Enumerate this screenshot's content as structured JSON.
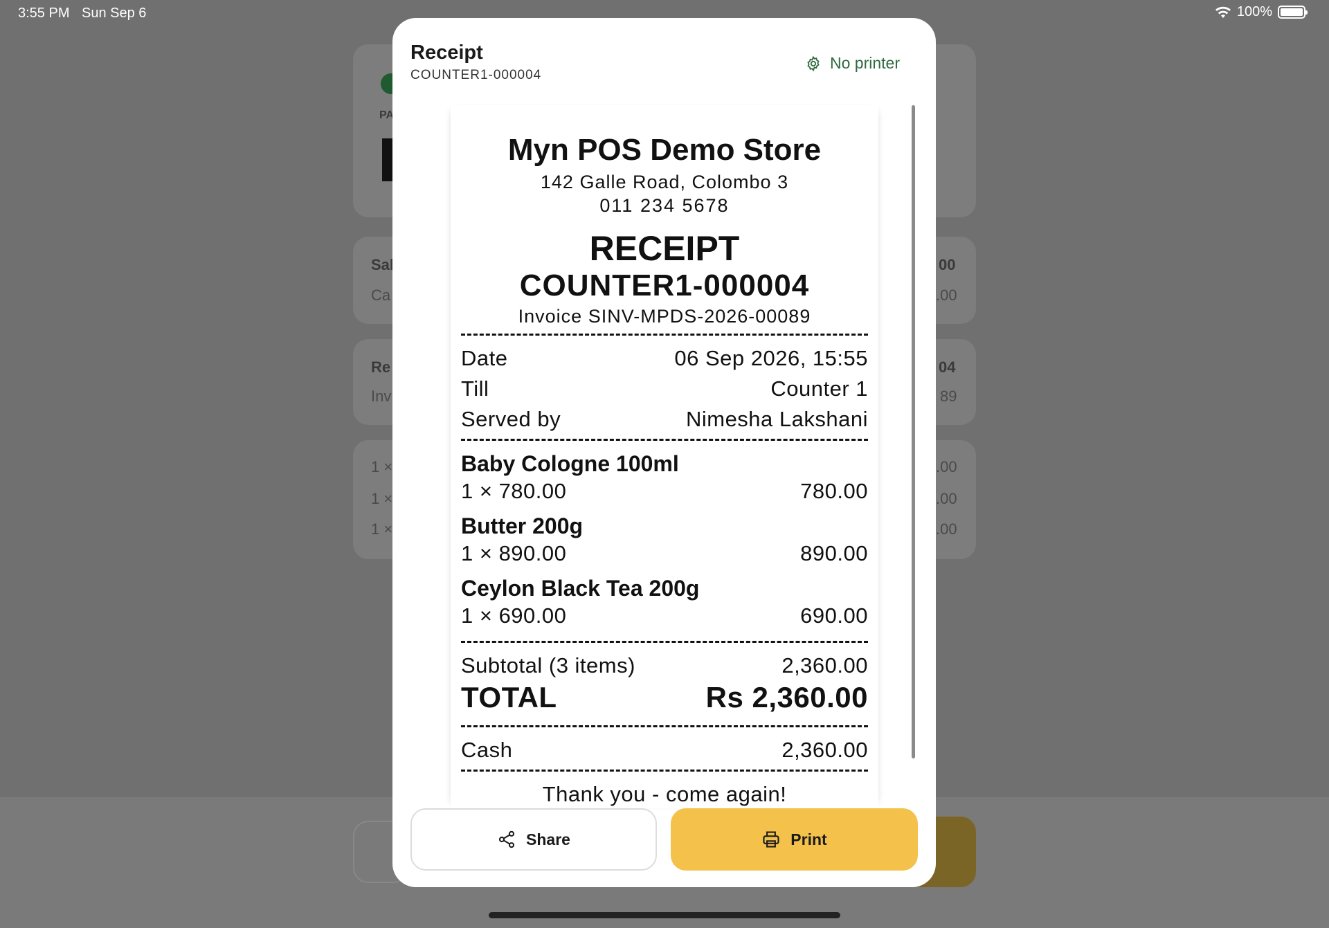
{
  "status_bar": {
    "time": "3:55 PM",
    "date": "Sun Sep 6",
    "battery": "100%"
  },
  "background": {
    "card1_label": "PA",
    "card2_title": "Sal",
    "card2_sub": "Ca",
    "card2_val1": "00",
    "card2_val2": ".00",
    "card3_title": "Re",
    "card3_sub": "Inv",
    "card3_val1": "04",
    "card3_val2": "89",
    "card4_rows": [
      "1 ×",
      "1 ×",
      "1 ×"
    ],
    "card4_vals": [
      ".00",
      ".00",
      ".00"
    ]
  },
  "modal": {
    "title": "Receipt",
    "subtitle": "COUNTER1-000004",
    "printer_status": "No printer"
  },
  "receipt": {
    "store_name": "Myn POS Demo Store",
    "address": "142 Galle Road, Colombo 3",
    "phone": "011 234 5678",
    "heading": "RECEIPT",
    "number": "COUNTER1-000004",
    "invoice": "Invoice SINV-MPDS-2026-00089",
    "date_label": "Date",
    "date_value": "06 Sep 2026, 15:55",
    "till_label": "Till",
    "till_value": "Counter 1",
    "served_label": "Served by",
    "served_value": "Nimesha Lakshani",
    "items": [
      {
        "name": "Baby Cologne 100ml",
        "qty_price": "1 × 780.00",
        "amount": "780.00"
      },
      {
        "name": "Butter 200g",
        "qty_price": "1 × 890.00",
        "amount": "890.00"
      },
      {
        "name": "Ceylon Black Tea 200g",
        "qty_price": "1 × 690.00",
        "amount": "690.00"
      }
    ],
    "subtotal_label": "Subtotal (3 items)",
    "subtotal_value": "2,360.00",
    "total_label": "TOTAL",
    "total_value": "Rs 2,360.00",
    "payment_label": "Cash",
    "payment_value": "2,360.00",
    "footer": "Thank you - come again!"
  },
  "actions": {
    "share_label": "Share",
    "print_label": "Print"
  },
  "colors": {
    "print_button": "#f4c14b",
    "printer_status": "#2f6a3f",
    "overlay": "#707070"
  },
  "icons": {
    "printer_status": "gear-icon",
    "share": "share-icon",
    "print": "printer-icon"
  }
}
